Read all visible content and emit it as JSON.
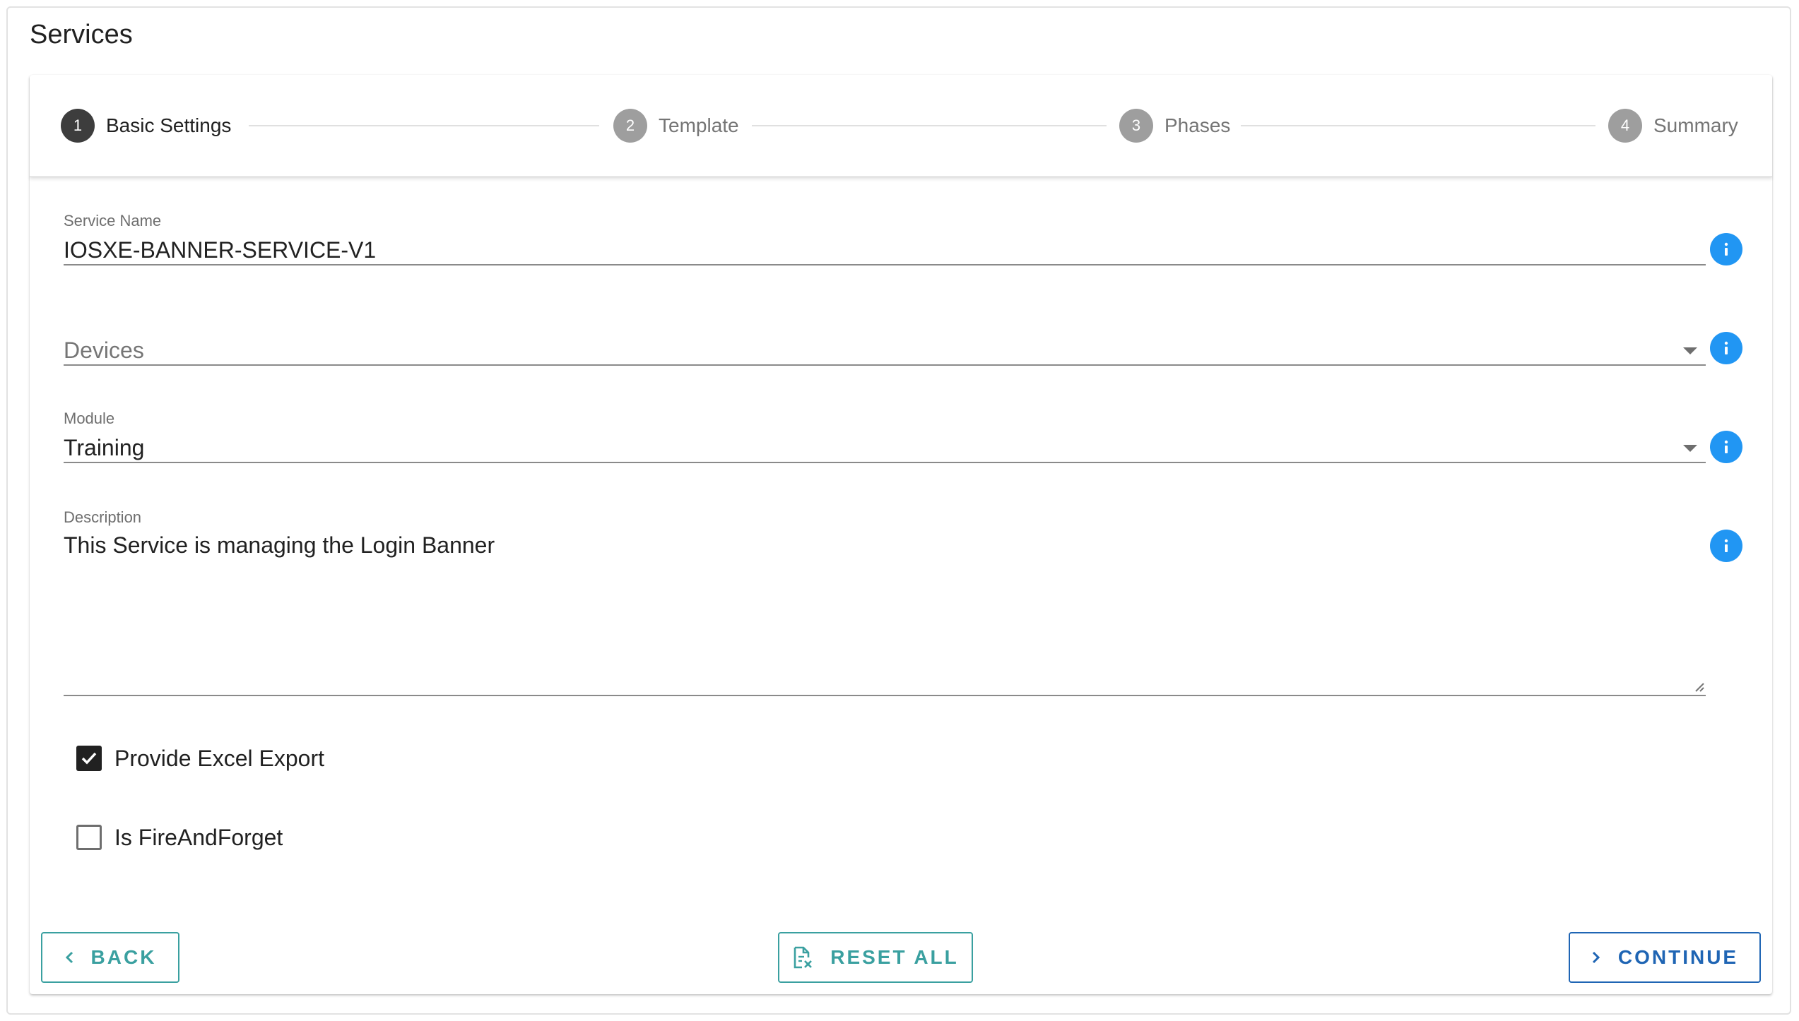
{
  "page": {
    "title": "Services"
  },
  "stepper": {
    "steps": [
      {
        "number": "1",
        "label": "Basic Settings",
        "state": "active"
      },
      {
        "number": "2",
        "label": "Template",
        "state": "inactive"
      },
      {
        "number": "3",
        "label": "Phases",
        "state": "inactive"
      },
      {
        "number": "4",
        "label": "Summary",
        "state": "inactive"
      }
    ]
  },
  "form": {
    "service_name": {
      "label": "Service Name",
      "value": "IOSXE-BANNER-SERVICE-V1"
    },
    "devices": {
      "placeholder": "Devices",
      "value": ""
    },
    "module": {
      "label": "Module",
      "value": "Training"
    },
    "description": {
      "label": "Description",
      "value": "This Service is managing the Login Banner"
    },
    "provide_excel_export": {
      "label": "Provide Excel Export",
      "checked": true
    },
    "is_fire_and_forget": {
      "label": "Is FireAndForget",
      "checked": false
    }
  },
  "actions": {
    "back_label": "BACK",
    "reset_label": "RESET ALL",
    "continue_label": "CONTINUE"
  },
  "icons": {
    "info": "info-icon",
    "dropdown": "dropdown-caret-icon",
    "back": "chevron-left-icon",
    "reset": "document-clear-icon",
    "continue": "chevron-right-icon",
    "check": "checkmark-icon"
  },
  "colors": {
    "info_blue": "#2196f3",
    "active_step": "#3d3d3d",
    "inactive_step": "#9e9e9e",
    "teal_button": "#3aa0a0",
    "blue_button": "#1f65b4",
    "checkbox_checked": "#212121"
  }
}
